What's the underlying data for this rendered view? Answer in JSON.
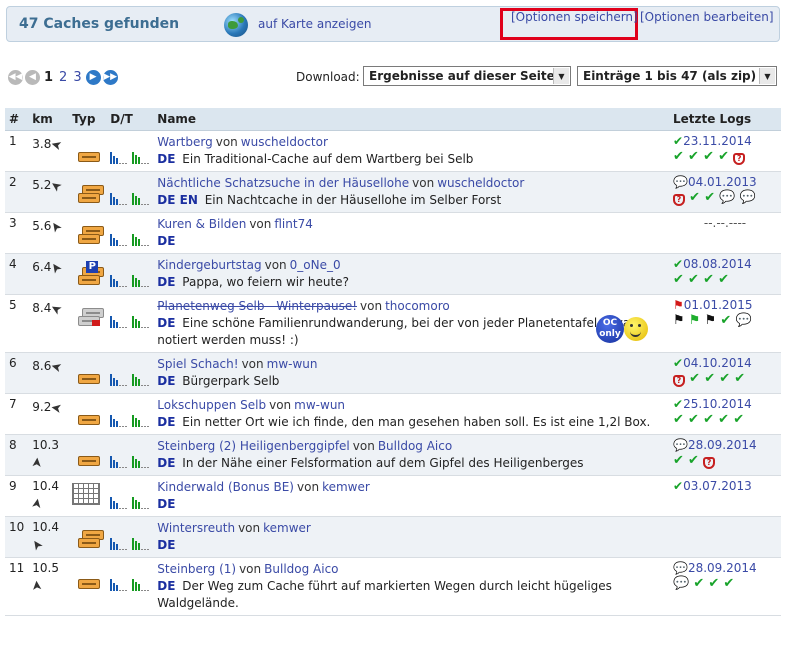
{
  "header": {
    "found_label": "47 Caches gefunden",
    "map_link": "auf Karte anzeigen",
    "save_options": "[Optionen speichern]",
    "edit_options": "[Optionen bearbeiten]"
  },
  "pager": {
    "pages": [
      "1",
      "2",
      "3"
    ],
    "current": "1"
  },
  "download": {
    "label": "Download:",
    "scope_selected": "Ergebnisse auf dieser Seite",
    "range_selected": "Einträge 1 bis 47 (als zip)"
  },
  "table": {
    "headers": {
      "num": "#",
      "km": "km",
      "typ": "Typ",
      "dt": "D/T",
      "name": "Name",
      "logs": "Letzte Logs"
    },
    "by_word": "von",
    "rows": [
      {
        "num": "1",
        "km": "3.8",
        "arrow": "➤",
        "name": "Wartberg",
        "owner": "wuscheldoctor",
        "langs": "DE",
        "desc": "Ein Traditional-Cache auf dem Wartberg bei Selb",
        "log_date": "23.11.2014"
      },
      {
        "num": "2",
        "km": "5.2",
        "arrow": "➤",
        "name": "Nächtliche Schatzsuche in der Häusellohe",
        "owner": "wuscheldoctor",
        "langs": "DE EN",
        "desc": "Ein Nachtcache in der Häusellohe im Selber Forst",
        "log_date": "04.01.2013"
      },
      {
        "num": "3",
        "km": "5.6",
        "arrow": "➤",
        "name": "Kuren & Bilden",
        "owner": "flint74",
        "langs": "DE",
        "desc": "",
        "log_date": "--.--.----"
      },
      {
        "num": "4",
        "km": "6.4",
        "arrow": "➤",
        "name": "Kindergeburtstag",
        "owner": "0_oNe_0",
        "langs": "DE",
        "desc": "Pappa, wo feiern wir heute?",
        "log_date": "08.08.2014"
      },
      {
        "num": "5",
        "km": "8.4",
        "arrow": "➤",
        "name": "Planetenweg Selb - Winterpause!",
        "owner": "thocomoro",
        "langs": "DE",
        "desc": "Eine schöne Familienrundwanderung, bei der von jeder Planetentafel etwas notiert werden muss! :)",
        "log_date": "01.01.2015",
        "oc_badge": "OC only"
      },
      {
        "num": "6",
        "km": "8.6",
        "arrow": "➤",
        "name": "Spiel Schach!",
        "owner": "mw-wun",
        "langs": "DE",
        "desc": "Bürgerpark Selb",
        "log_date": "04.10.2014"
      },
      {
        "num": "7",
        "km": "9.2",
        "arrow": "➤",
        "name": "Lokschuppen Selb",
        "owner": "mw-wun",
        "langs": "DE",
        "desc": "Ein netter Ort wie ich finde, den man gesehen haben soll. Es ist eine 1,2l Box.",
        "log_date": "25.10.2014"
      },
      {
        "num": "8",
        "km": "10.3",
        "arrow": "➤",
        "name": "Steinberg (2) Heiligenberggipfel",
        "owner": "Bulldog Aico",
        "langs": "DE",
        "desc": "In der Nähe einer Felsformation auf dem Gipfel des Heiligenberges",
        "log_date": "28.09.2014"
      },
      {
        "num": "9",
        "km": "10.4",
        "arrow": "➤",
        "name": "Kinderwald (Bonus BE)",
        "owner": "kemwer",
        "langs": "DE",
        "desc": "",
        "log_date": "03.07.2013"
      },
      {
        "num": "10",
        "km": "10.4",
        "arrow": "➤",
        "name": "Wintersreuth",
        "owner": "kemwer",
        "langs": "DE",
        "desc": "",
        "log_date": ""
      },
      {
        "num": "11",
        "km": "10.5",
        "arrow": "➤",
        "name": "Steinberg (1)",
        "owner": "Bulldog Aico",
        "langs": "DE",
        "desc": "Der Weg zum Cache führt auf markierten Wegen durch leicht hügeliges Waldgelände.",
        "log_date": "28.09.2014"
      }
    ]
  },
  "colors": {
    "accent": "#3a4aa6",
    "header_bg": "#e7edf4",
    "highlight": "#e0001b",
    "found": "#18a32a"
  }
}
